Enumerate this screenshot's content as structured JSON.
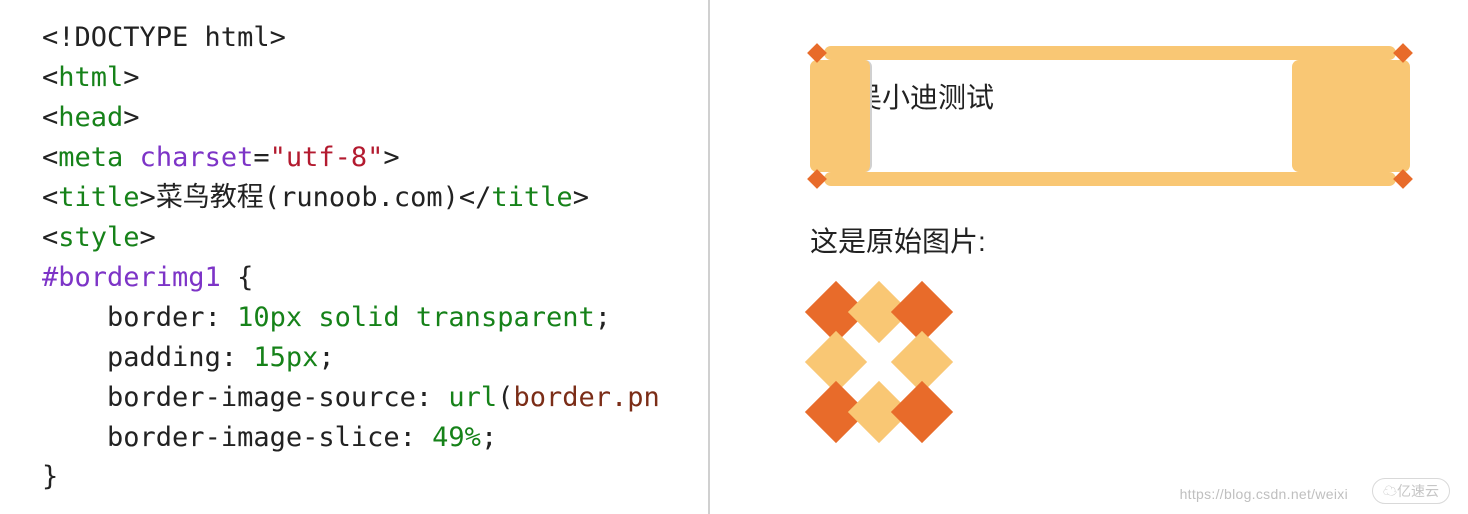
{
  "code": {
    "doctype": "<!DOCTYPE html>",
    "html_open": "html",
    "head_open": "head",
    "meta_tag": "meta",
    "meta_attr": "charset",
    "meta_val": "\"utf-8\"",
    "title_tag": "title",
    "title_text": "菜鸟教程(runoob.com)",
    "style_tag": "style",
    "selector": "#borderimg1",
    "brace_open": "{",
    "line1_prop": "border",
    "line1_val": "10px solid transparent",
    "line2_prop": "padding",
    "line2_val": "15px",
    "line3_prop": "border-image-source",
    "line3_func": "url",
    "line3_arg": "border.pn",
    "line4_prop": "border-image-slice",
    "line4_val": "49%",
    "brace_close": "}"
  },
  "preview": {
    "box_text": "吴小迪测试",
    "label_original": "这是原始图片:"
  },
  "watermark": {
    "url": "https://blog.csdn.net/weixi",
    "brand": "亿速云"
  }
}
